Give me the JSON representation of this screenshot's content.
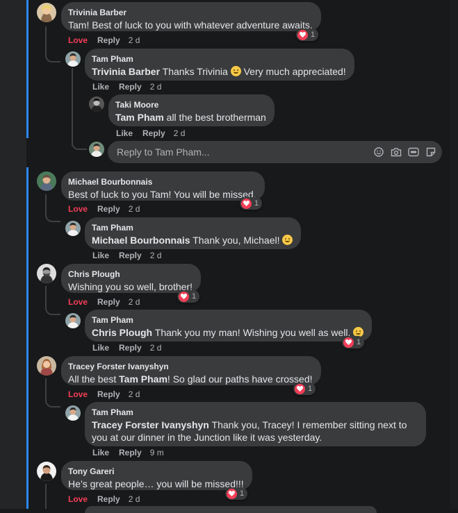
{
  "actions": {
    "like": "Like",
    "love": "Love",
    "reply": "Reply"
  },
  "reply_box": {
    "placeholder": "Reply to Tam Pham..."
  },
  "colors": {
    "background": "#18191a",
    "bubble": "#3a3b3c",
    "love": "#f33e58",
    "accent_bar": "#2d88ff"
  },
  "comments": [
    {
      "author": "Trivinia Barber",
      "text": "Tam! Best of luck to you with whatever adventure awaits.",
      "time": "2 d",
      "reaction_count": "1",
      "reaction": "love-icon"
    },
    {
      "author": "Tam Pham",
      "mention": "Trivinia Barber",
      "text": " Thanks Trivinia",
      "text_after": " Very much appreciated!",
      "time": "2 d"
    },
    {
      "author": "Taki Moore",
      "mention": "Tam Pham",
      "text": " all the best brotherman",
      "time": "2 d"
    },
    {
      "author": "Michael Bourbonnais",
      "text": "Best of luck to you Tam! You will be missed.",
      "time": "2 d",
      "reaction_count": "1",
      "reaction": "love-icon"
    },
    {
      "author": "Tam Pham",
      "mention": "Michael Bourbonnais",
      "text": " Thank you, Michael!",
      "time": "2 d"
    },
    {
      "author": "Chris Plough",
      "text": "Wishing you so well, brother!",
      "time": "2 d",
      "reaction_count": "1",
      "reaction": "love-icon"
    },
    {
      "author": "Tam Pham",
      "mention": "Chris Plough",
      "text": " Thank you my man! Wishing you well as well.",
      "time": "2 d",
      "reaction_count": "1",
      "reaction": "love-icon"
    },
    {
      "author": "Tracey Forster Ivanyshyn",
      "text": "All the best ",
      "mention": "Tam Pham",
      "text_after": "! So glad our paths have crossed!",
      "time": "2 d",
      "reaction_count": "1",
      "reaction": "love-icon"
    },
    {
      "author": "Tam Pham",
      "mention": "Tracey Forster Ivanyshyn",
      "text": " Thank you, Tracey! I remember sitting next to you at our dinner in the Junction like it was yesterday.",
      "time": "9 m"
    },
    {
      "author": "Tony Gareri",
      "text": "He’s great people… you will be missed!!!",
      "time": "2 d",
      "reaction_count": "1",
      "reaction": "love-icon"
    }
  ]
}
